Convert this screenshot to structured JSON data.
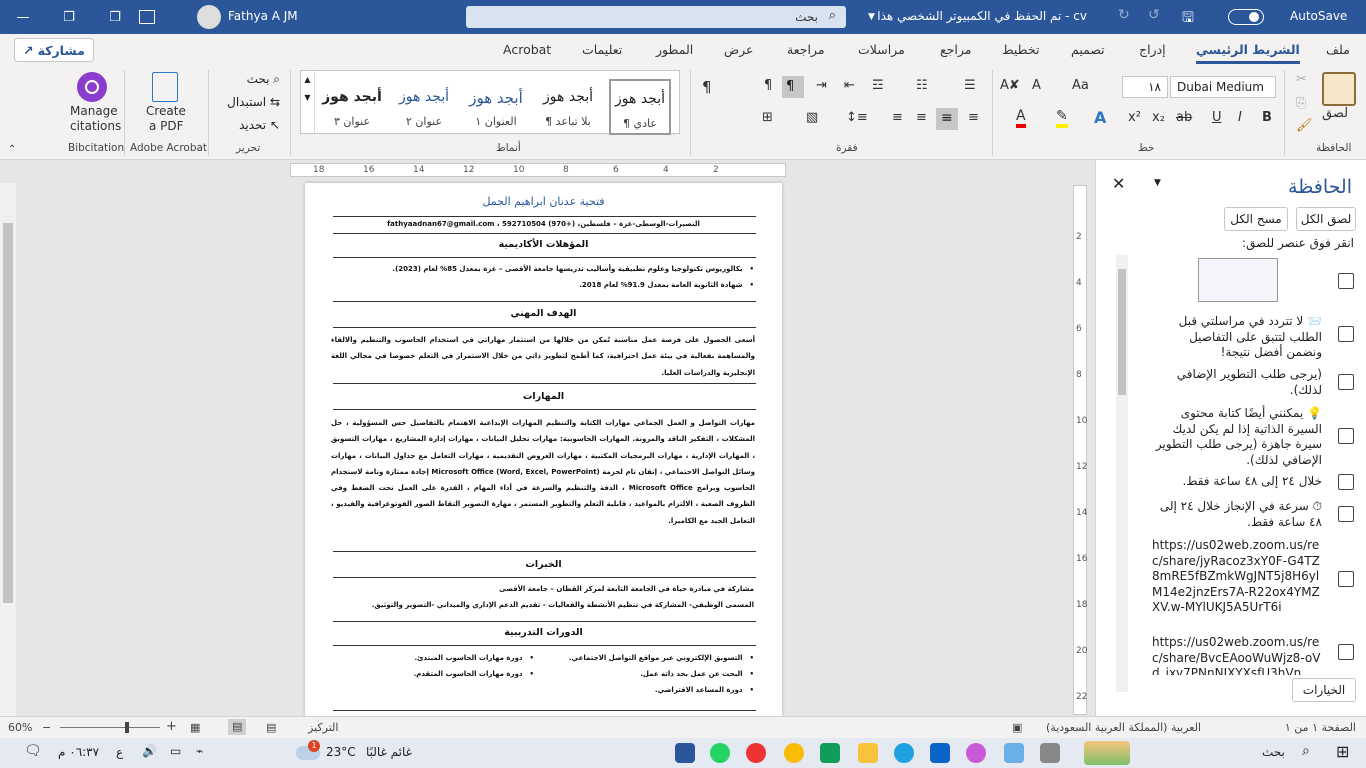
{
  "titlebar": {
    "autosave": "AutoSave",
    "doc_title": "cv  -  تم الحفظ في الكمبيوتر الشخصي هذا",
    "search": "بحث",
    "user": "Fathya A JM"
  },
  "tabs": [
    "ملف",
    "الشريط الرئيسي",
    "إدراج",
    "تصميم",
    "تخطيط",
    "مراجع",
    "مراسلات",
    "مراجعة",
    "عرض",
    "المطور",
    "تعليمات",
    "Acrobat"
  ],
  "share": "مشاركة",
  "ribbon": {
    "groups": {
      "clipboard": "الحافظة",
      "font": "خط",
      "paragraph": "فقرة",
      "styles": "أنماط",
      "editing": "تحرير",
      "acrobat": "Adobe Acrobat",
      "bibcitation": "Bibcitation"
    },
    "paste": "لصق",
    "font_name": "Dubai Medium",
    "font_size": "١٨",
    "styles": [
      {
        "preview": "أبجد هوز",
        "name": "¶ عادي"
      },
      {
        "preview": "أبجد هوز",
        "name": "¶ بلا تباعد"
      },
      {
        "preview": "أبجد هوز",
        "name": "العنوان ١"
      },
      {
        "preview": "أبجد هوز",
        "name": "عنوان ٢"
      },
      {
        "preview": "أبجد هوز",
        "name": "عنوان ٣"
      }
    ],
    "editing": {
      "find": "بحث",
      "replace": "استبدال",
      "select": "تحديد"
    },
    "acrobat": {
      "create": "Create",
      "pdf": "a PDF"
    },
    "bib": {
      "manage": "Manage",
      "citations": "citations"
    }
  },
  "ruler_h": [
    "18",
    "16",
    "14",
    "12",
    "10",
    "8",
    "6",
    "4",
    "2"
  ],
  "ruler_v": [
    "2",
    "4",
    "6",
    "8",
    "10",
    "12",
    "14",
    "16",
    "18",
    "20",
    "22"
  ],
  "doc": {
    "name": "فتحية عدنان ابراهيم الجمل",
    "contact": "النصيرات-الوسطى-غزة – فلسطين، fathyaadnan67@gmail.com ، 592710504 (970+)",
    "h_quals": "المؤهلات الأكاديمية",
    "quals": [
      "بكالوريوس تكنولوجيا وعلوم تطبيقية وأساليب تدريسها جامعة الأقصى – غزة بمعدل 85% لعام (2023).",
      "شهادة الثانوية العامة بمعدل 91.9% لعام 2018."
    ],
    "h_goal": "الهدف المهني",
    "goal": "أسعى الحصول على فرصة عمل مناسبة تُمكن من خلالها من استثمار مهاراتي في استخدام الحاسوب والتنظيم والالقاء والمساهمة بفعالية في بيئة عمل احترافية، كما أطمح لتطوير ذاتي من خلال الاستمرار في التعلم خصوصا في مجالي اللغة الإنجليزية والدراسات العليا.",
    "h_skills": "المهارات",
    "skills": "مهارات التواصل و العمل الجماعي مهارات الكتابة والتنظيم المهارات الإبداعية الاهتمام بالتفاصيل حس المسؤولية ، حل المشكلات ، التفكير الناقد والمرونة. المهارات الحاسوبية: مهارات تحليل البيانات ، مهارات إدارة المشاريع ، مهارات التسويق ، المهارات الإدارية ، مهارات البرمجيات المكتبية ، مهارات العروض التقديمية ، مهارات التعامل مع جداول البيانات ، مهارات وسائل التواصل الاجتماعي ، إتقان تام لحزمة (Word, Excel, PowerPoint) Microsoft Office إجادة ممتازة وتامة لاستخدام الحاسوب وبرامج Microsoft Office ، الدقة والتنظيم والسرعة في أداء المهام ، القدرة على العمل تحت الضغط وفي الظروف الصعبة ، الالتزام بالمواعيد ، قابلية التعلم والتطوير المستمر ، مهارة التصوير التقاط الصور الفوتوغرافية والفيديو ، التعامل الجيد مع الكاميرا.",
    "h_exp": "الخبرات",
    "exp": [
      "مشاركة في مبادرة حياة في الجامعة التابعة لمركز القطان – جامعة الأقصى",
      "المسمى الوظيفي- المشاركة في تنظيم الأنشطة والفعاليات - تقديم الدعم الإداري والميداني -التصوير والتوثيق."
    ],
    "h_courses": "الدورات التدريبية",
    "courses_right": [
      "التسويق الإلكتروني عبر مواقع التواصل الاجتماعي.",
      "البحث عن عمل بحد ذاته عمل.",
      "دورة المساعد الافتراضي."
    ],
    "courses_left": [
      "دورة مهارات الحاسوب المبتدئ.",
      "دورة مهارات الحاسوب المتقدم."
    ]
  },
  "pane": {
    "title": "الحافظة",
    "paste_all": "لصق الكل",
    "clear_all": "مسح الكل",
    "hint": "انقر فوق عنصر للصق:",
    "items": [
      "📨 لا تتردد في مراسلتي قبل الطلب لتتبق على التفاصيل ونضمن أفضل نتيجة!",
      "(يرجى طلب التطوير الإضافي لذلك).",
      "💡 يمكنني أيضًا كتابة محتوى السيرة الذاتية إذا لم يكن لديك سيرة جاهزة (يرجى طلب التطوير الإضافي لذلك).",
      "خلال ٢٤ إلى ٤٨ ساعة فقط.",
      "⏱ سرعة في الإنجاز خلال ٢٤ إلى ٤٨ ساعة فقط.",
      "https://us02web.zoom.us/rec/share/jyRacoz3xY0F-G4TZ8mRE5fBZmkWgJNT5j8H6ylM14e2jnzErs7A-R22ox4YMZXV.w-MYlUKJ5A5UrT6i",
      "https://us02web.zoom.us/rec/share/BvcEAooWuWjz8-oVd_ixv7PNnNIXYXsfU3hVn"
    ],
    "options": "الخيارات"
  },
  "status": {
    "page": "الصفحة ١ من ١",
    "lang": "العربية (المملكة العربية السعودية)",
    "focus": "التركيز",
    "zoom": "60%"
  },
  "taskbar": {
    "search": "بحث",
    "weather_temp": "23°C",
    "weather_desc": "غائم غالبًا",
    "time": "٠٦:٣٧ م",
    "lang": "ع",
    "badge": "1"
  }
}
